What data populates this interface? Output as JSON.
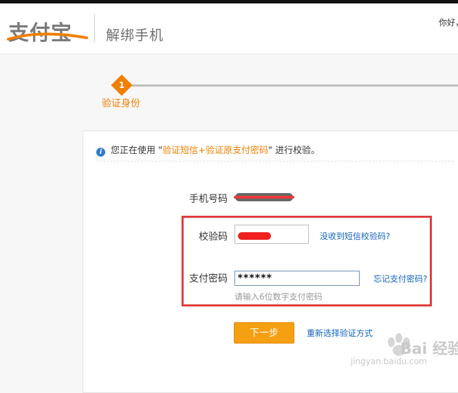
{
  "header": {
    "logo_text": "支付宝",
    "page_title": "解绑手机",
    "greeting": "你好，"
  },
  "stepper": {
    "steps": [
      {
        "number": "1",
        "label": "验证身份",
        "active": true
      }
    ]
  },
  "info": {
    "prefix": "您正在使用 \"",
    "highlight": "验证短信+验证原支付密码",
    "suffix": "\" 进行校验。"
  },
  "form": {
    "phone_label": "手机号码",
    "code_label": "校验码",
    "code_link": "没收到短信校验码?",
    "password_label": "支付密码",
    "password_value": "******",
    "password_link": "忘记支付密码?",
    "password_hint": "请输入6位数字支付密码",
    "next_button": "下一步",
    "reselect_link": "重新选择验证方式"
  },
  "watermark": {
    "text": "Bai 经验",
    "sub": "jingyan.baidu.com"
  },
  "colors": {
    "accent_orange": "#f07f00",
    "button_orange": "#f59f13",
    "link_blue": "#1063c1",
    "annotation_red": "#e03c3c"
  }
}
